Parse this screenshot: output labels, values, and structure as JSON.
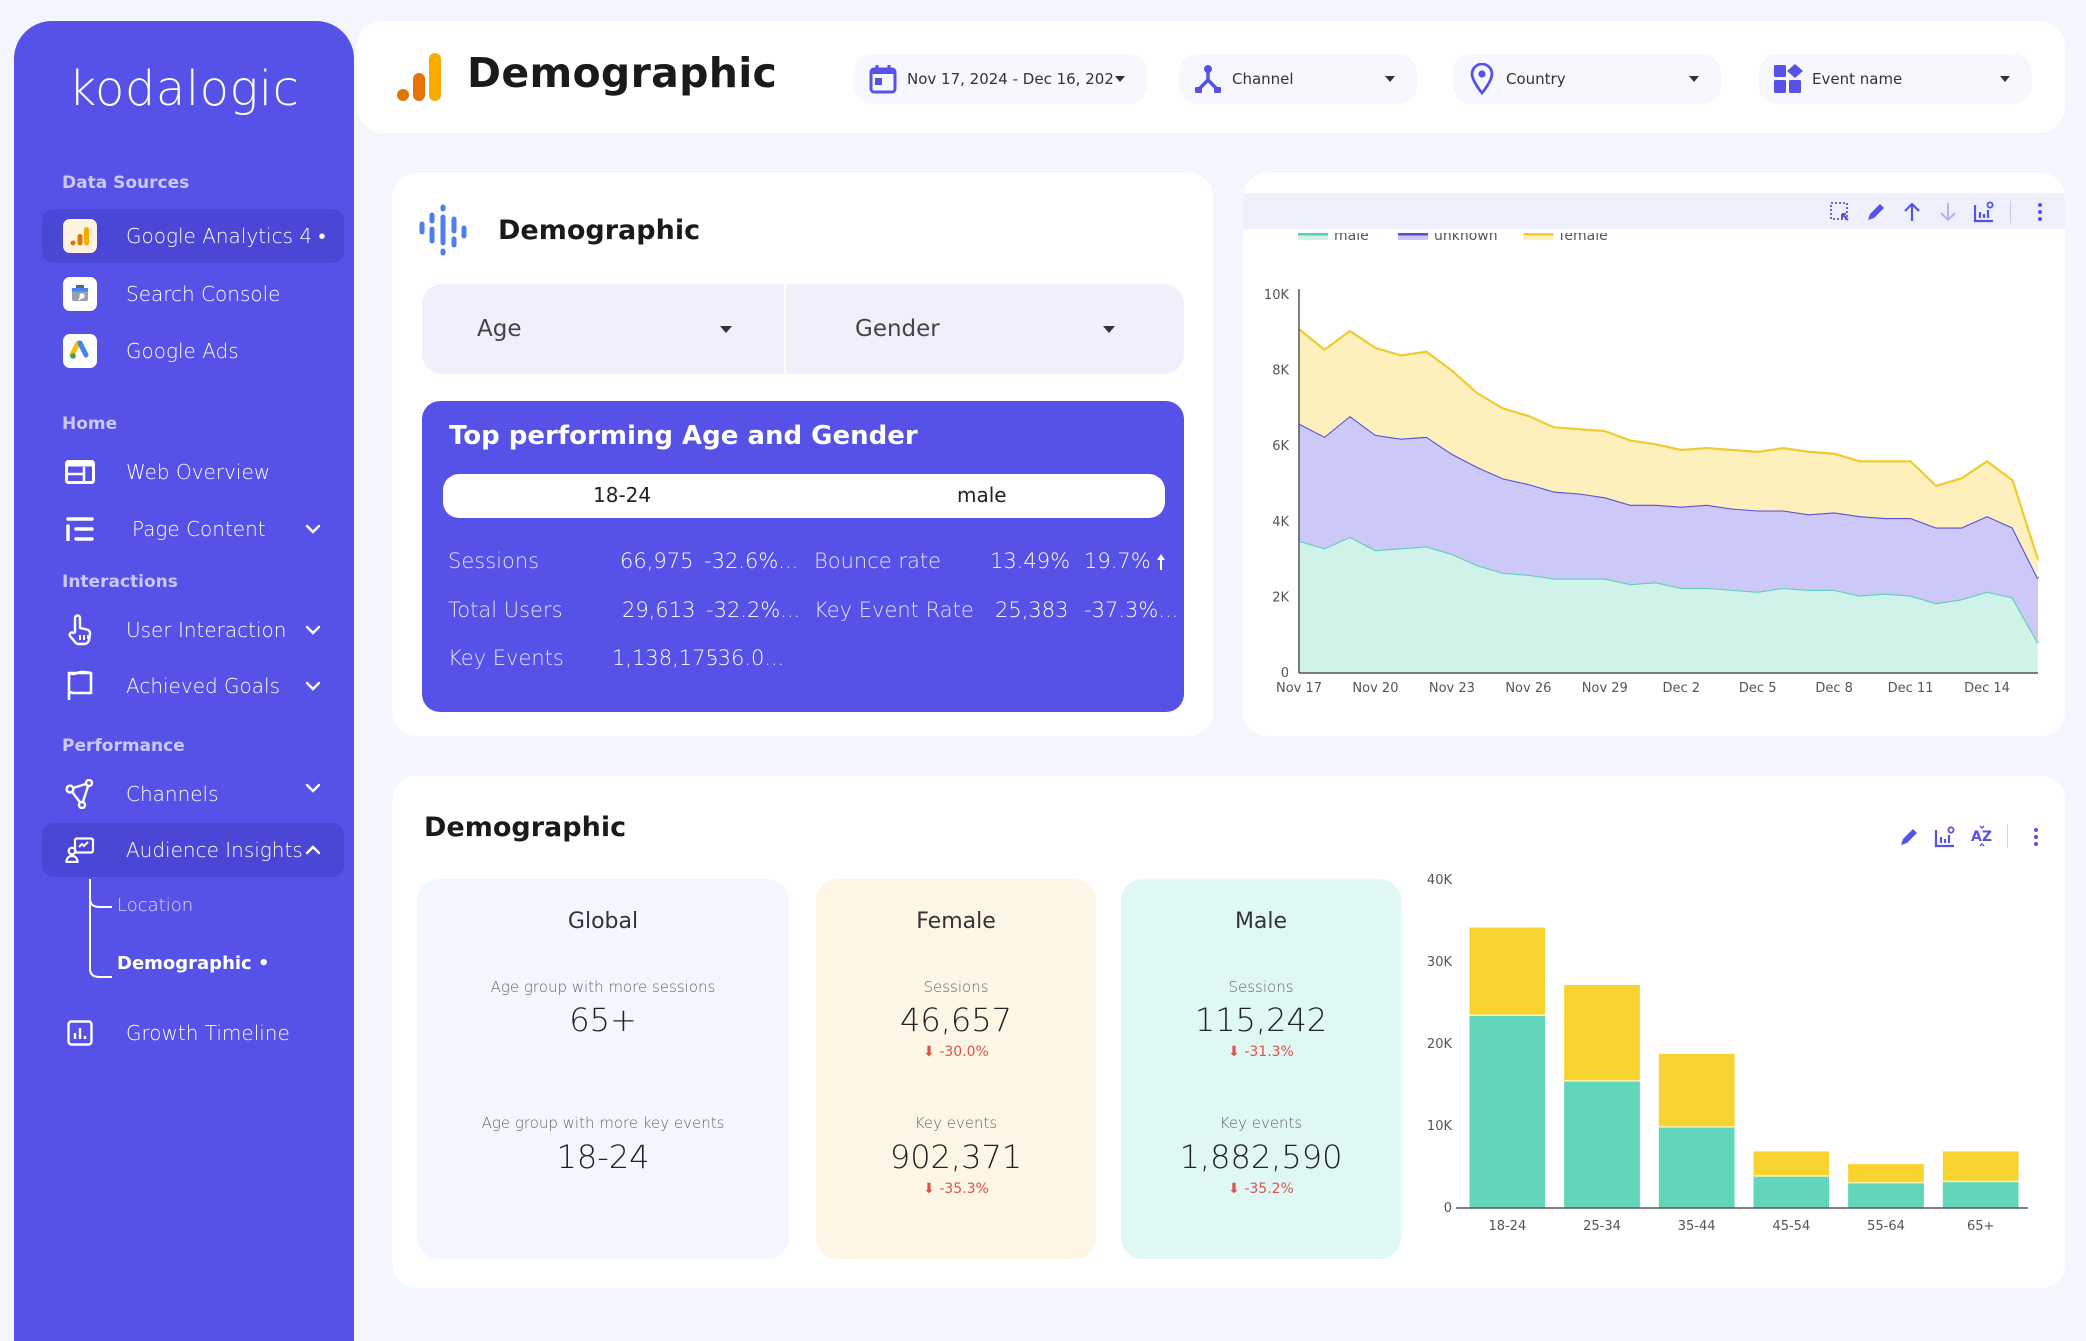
{
  "sidebar": {
    "logo": "kodalogic",
    "sections": {
      "data_sources": "Data Sources",
      "home": "Home",
      "interactions": "Interactions",
      "performance": "Performance"
    },
    "items": {
      "ga4": "Google Analytics 4 •",
      "search_console": "Search Console",
      "google_ads": "Google Ads",
      "web_overview": "Web Overview",
      "page_content": "Page Content",
      "user_interaction": "User Interaction",
      "achieved_goals": "Achieved Goals",
      "channels": "Channels",
      "audience_insights": "Audience Insights",
      "location": "Location",
      "demographic": "Demographic •",
      "growth_timeline": "Growth Timeline"
    }
  },
  "header": {
    "title": "Demographic",
    "filters": {
      "date": "Nov 17, 2024 - Dec 16, 202",
      "channel": "Channel",
      "country": "Country",
      "event_name": "Event name"
    }
  },
  "demographic_card": {
    "title": "Demographic",
    "age_dropdown": "Age",
    "gender_dropdown": "Gender",
    "top_performing": {
      "title": "Top performing Age and Gender",
      "age": "18-24",
      "gender": "male",
      "metrics": [
        {
          "label": "Sessions",
          "value": "66,975",
          "delta": "-32.6%..."
        },
        {
          "label": "Total Users",
          "value": "29,613",
          "delta": "-32.2%..."
        },
        {
          "label": "Key Events",
          "value": "1,138,175",
          "delta": "-36.0..."
        },
        {
          "label": "Bounce rate",
          "value": "13.49%",
          "delta": "19.7%"
        },
        {
          "label": "Key Event Rate",
          "value": "25,383",
          "delta": "-37.3%..."
        }
      ]
    }
  },
  "bottom": {
    "title": "Demographic",
    "global": {
      "title": "Global",
      "sessions_label": "Age group with more sessions",
      "sessions_value": "65+",
      "events_label": "Age group with more key events",
      "events_value": "18-24"
    },
    "female": {
      "title": "Female",
      "sessions_label": "Sessions",
      "sessions_value": "46,657",
      "sessions_delta": "-30.0%",
      "events_label": "Key events",
      "events_value": "902,371",
      "events_delta": "-35.3%"
    },
    "male": {
      "title": "Male",
      "sessions_label": "Sessions",
      "sessions_value": "115,242",
      "sessions_delta": "-31.3%",
      "events_label": "Key events",
      "events_value": "1,882,590",
      "events_delta": "-35.2%"
    }
  },
  "colors": {
    "primary": "#5652e8",
    "male": "#5fd4b8",
    "unknown": "#5a4fd6",
    "female": "#f5d02f",
    "delta_negative": "#d9534f"
  },
  "chart_data": [
    {
      "type": "area",
      "stacked": true,
      "title": "",
      "xlabel": "",
      "ylabel": "",
      "ylim": [
        0,
        10000
      ],
      "yticks": [
        "0",
        "2K",
        "4K",
        "6K",
        "8K",
        "10K"
      ],
      "ytick_values": [
        0,
        2000,
        4000,
        6000,
        8000,
        10000
      ],
      "xtick_labels": [
        "Nov 17",
        "Nov 20",
        "Nov 23",
        "Nov 26",
        "Nov 29",
        "Dec 2",
        "Dec 5",
        "Dec 8",
        "Dec 11",
        "Dec 14"
      ],
      "legend": {
        "position": "top-left",
        "entries": [
          "male",
          "unknown",
          "female"
        ]
      },
      "x": [
        "Nov 17",
        "Nov 18",
        "Nov 19",
        "Nov 20",
        "Nov 21",
        "Nov 22",
        "Nov 23",
        "Nov 24",
        "Nov 25",
        "Nov 26",
        "Nov 27",
        "Nov 28",
        "Nov 29",
        "Nov 30",
        "Dec 1",
        "Dec 2",
        "Dec 3",
        "Dec 4",
        "Dec 5",
        "Dec 6",
        "Dec 7",
        "Dec 8",
        "Dec 9",
        "Dec 10",
        "Dec 11",
        "Dec 12",
        "Dec 13",
        "Dec 14",
        "Dec 15",
        "Dec 16"
      ],
      "series": [
        {
          "name": "male",
          "values": [
            3500,
            3300,
            3600,
            3250,
            3300,
            3350,
            3150,
            2850,
            2650,
            2600,
            2500,
            2500,
            2500,
            2350,
            2400,
            2250,
            2250,
            2200,
            2150,
            2250,
            2200,
            2200,
            2050,
            2100,
            2050,
            1850,
            1950,
            2150,
            2000,
            800
          ]
        },
        {
          "name": "unknown",
          "values": [
            3100,
            2950,
            3200,
            3050,
            2900,
            2900,
            2650,
            2600,
            2500,
            2400,
            2300,
            2250,
            2150,
            2100,
            2050,
            2150,
            2200,
            2150,
            2150,
            2050,
            2000,
            2050,
            2100,
            2000,
            2050,
            2000,
            1900,
            2000,
            1850,
            1700
          ]
        },
        {
          "name": "female",
          "values": [
            2500,
            2300,
            2250,
            2300,
            2200,
            2250,
            2200,
            1950,
            1850,
            1800,
            1700,
            1700,
            1750,
            1700,
            1600,
            1500,
            1500,
            1550,
            1550,
            1650,
            1650,
            1550,
            1450,
            1500,
            1500,
            1100,
            1300,
            1450,
            1250,
            500
          ]
        }
      ]
    },
    {
      "type": "bar",
      "stacked": true,
      "title": "",
      "xlabel": "",
      "ylabel": "",
      "ylim": [
        0,
        40000
      ],
      "yticks": [
        "0",
        "10K",
        "20K",
        "30K",
        "40K"
      ],
      "ytick_values": [
        0,
        10000,
        20000,
        30000,
        40000
      ],
      "categories": [
        "18-24",
        "25-34",
        "35-44",
        "45-54",
        "55-64",
        "65+"
      ],
      "series": [
        {
          "name": "male",
          "values": [
            23500,
            15500,
            9900,
            3900,
            3100,
            3250
          ]
        },
        {
          "name": "female",
          "values": [
            10700,
            11700,
            8900,
            3000,
            2250,
            3650
          ]
        }
      ]
    }
  ]
}
